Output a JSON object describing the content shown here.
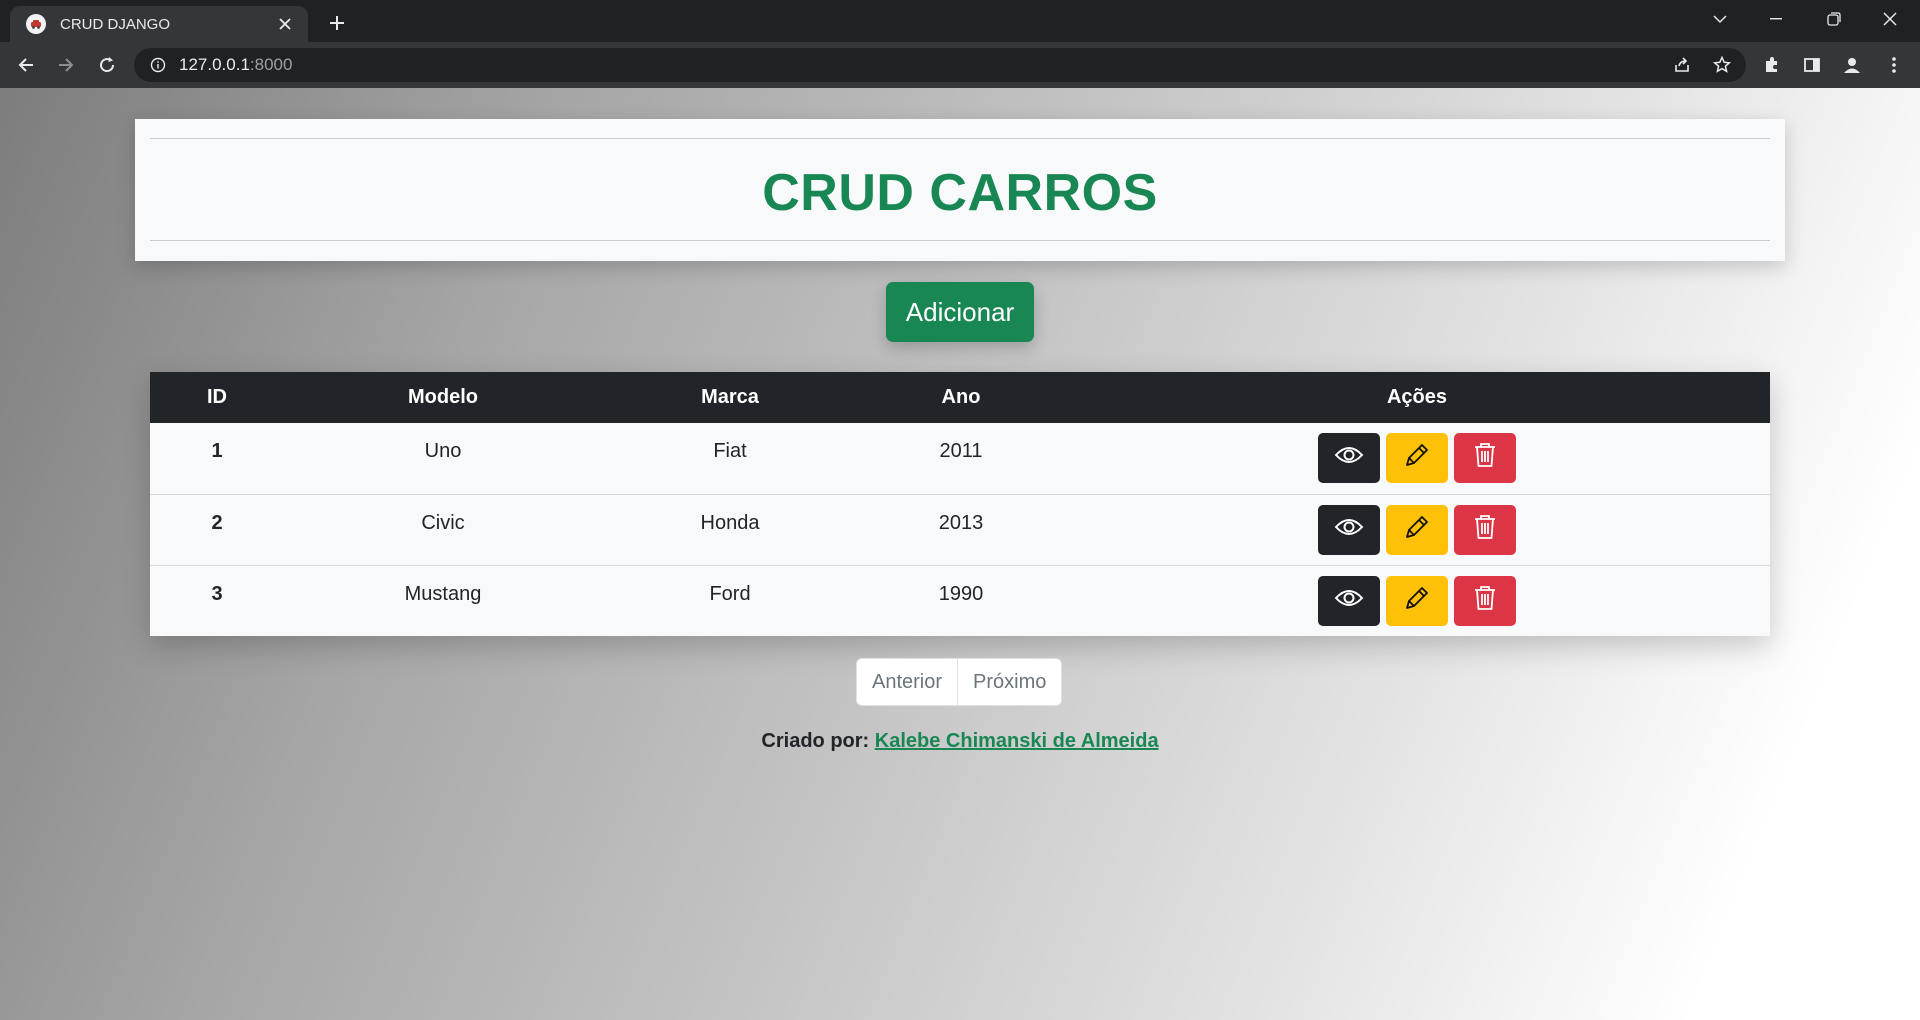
{
  "browser": {
    "tab_title": "CRUD DJANGO",
    "url_host": "127.0.0.1",
    "url_port": ":8000"
  },
  "page": {
    "title": "CRUD CARROS",
    "add_button": "Adicionar",
    "table": {
      "headers": [
        "ID",
        "Modelo",
        "Marca",
        "Ano",
        "Ações"
      ],
      "rows": [
        {
          "id": "1",
          "modelo": "Uno",
          "marca": "Fiat",
          "ano": "2011"
        },
        {
          "id": "2",
          "modelo": "Civic",
          "marca": "Honda",
          "ano": "2013"
        },
        {
          "id": "3",
          "modelo": "Mustang",
          "marca": "Ford",
          "ano": "1990"
        }
      ],
      "actions": [
        "eye-icon",
        "pencil-icon",
        "trash-icon"
      ]
    },
    "pagination": {
      "previous": "Anterior",
      "next": "Próximo"
    },
    "footer": {
      "prefix": "Criado por:",
      "author": "Kalebe Chimanski de Almeida"
    }
  },
  "colors": {
    "primary_green": "#198754",
    "dark": "#212529",
    "warning": "#ffc107",
    "danger": "#dc3545"
  }
}
